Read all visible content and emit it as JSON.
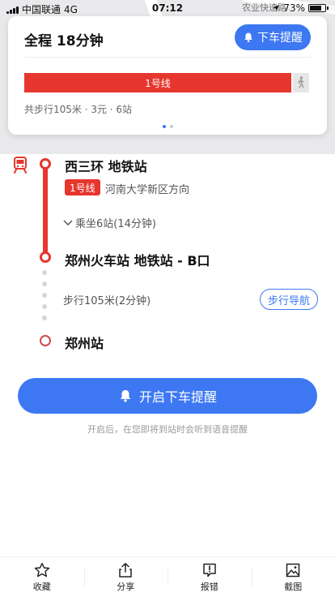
{
  "status_bar": {
    "carrier": "中国联通",
    "network": "4G",
    "time": "07:12",
    "battery": "73%",
    "map_label": "农业快速路"
  },
  "summary_card": {
    "title": "全程  18分钟",
    "remind_button": "下车提醒",
    "line_bar_label": "1号线",
    "summary": "共步行105米 · 3元 · 6站",
    "page_count": 2,
    "active_page": 1
  },
  "route": {
    "start_station": "西三环 地铁站",
    "line_badge": "1号线",
    "direction": "河南大学新区方向",
    "ride_info": "乘坐6站(14分钟)",
    "exit_station": "郑州火车站 地铁站 - B口",
    "walk_info": "步行105米(2分钟)",
    "walk_nav_button": "步行导航",
    "end_station": "郑州站"
  },
  "main_action": {
    "label": "开启下车提醒",
    "hint": "开启后，在您即将到站时会听到语音提醒"
  },
  "toolbar": {
    "items": [
      {
        "label": "收藏",
        "icon": "star-icon"
      },
      {
        "label": "分享",
        "icon": "share-icon"
      },
      {
        "label": "报错",
        "icon": "report-icon"
      },
      {
        "label": "截图",
        "icon": "screenshot-icon"
      }
    ]
  },
  "colors": {
    "accent": "#3d78f2",
    "line1": "#e6362d"
  }
}
